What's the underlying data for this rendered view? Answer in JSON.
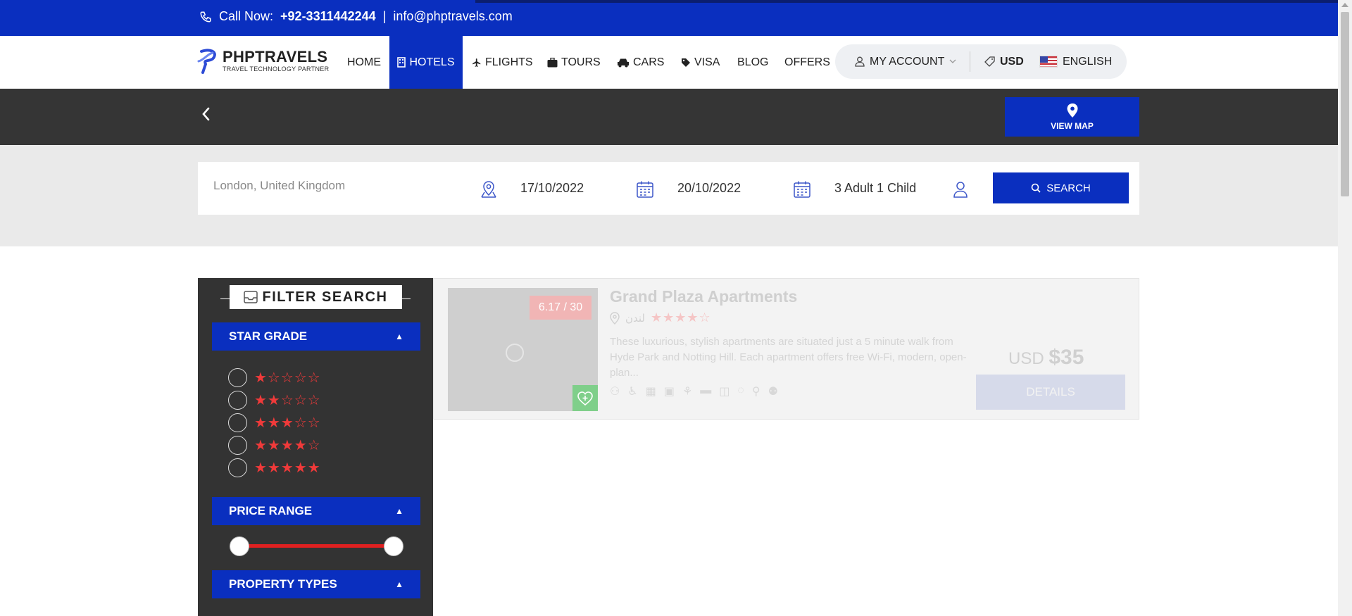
{
  "topbar": {
    "call_label": "Call Now:",
    "phone": "+92-3311442244",
    "separator": "|",
    "email": "info@phptravels.com"
  },
  "logo": {
    "brand": "PHPTRAVELS",
    "tagline": "TRAVEL TECHNOLOGY PARTNER"
  },
  "nav": {
    "home": "HOME",
    "hotels": "HOTELS",
    "flights": "FLIGHTS",
    "tours": "TOURS",
    "cars": "CARS",
    "visa": "VISA",
    "blog": "BLOG",
    "offers": "OFFERS",
    "my_account": "MY ACCOUNT",
    "currency": "USD",
    "language": "ENGLISH"
  },
  "map_button": {
    "label": "VIEW MAP"
  },
  "search": {
    "destination_placeholder": "London, United Kingdom",
    "checkin": "17/10/2022",
    "checkout": "20/10/2022",
    "guests": "3 Adult 1 Child",
    "button": "SEARCH"
  },
  "filters": {
    "title": "FILTER SEARCH",
    "star_grade": "STAR GRADE",
    "price_range": "PRICE RANGE",
    "property_types": "PROPERTY TYPES",
    "star_options": [
      {
        "stars": "★☆☆☆☆"
      },
      {
        "stars": "★★☆☆☆"
      },
      {
        "stars": "★★★☆☆"
      },
      {
        "stars": "★★★★☆"
      },
      {
        "stars": "★★★★★"
      }
    ],
    "price_min": 0,
    "price_max": 1
  },
  "hotel": {
    "name": "Grand Plaza Apartments",
    "rating": "6.17 / 30",
    "location": "لندن",
    "stars": "★★★★☆",
    "description": "These luxurious, stylish apartments are situated just a 5 minute walk from Hyde Park and Notting Hill. Each apartment offers free Wi-Fi, modern, open-plan...",
    "currency": "USD",
    "price": "$35",
    "details_label": "DETAILS"
  },
  "colors": {
    "primary": "#0a2fbf",
    "dark": "#353535",
    "star": "#f03a3a"
  }
}
